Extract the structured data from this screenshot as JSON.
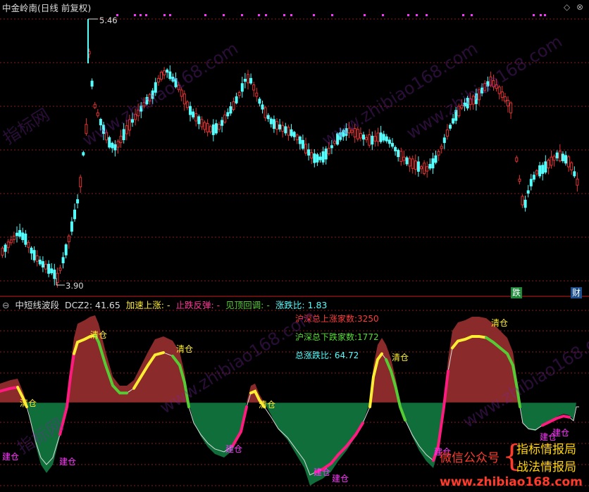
{
  "main_panel": {
    "title": "中金岭南(日线 前复权)",
    "high_label": "5.46",
    "low_label": "3.90",
    "badges": [
      "跌",
      "财"
    ]
  },
  "indicator_panel": {
    "title": "中短线波段",
    "dcz2_label": "DCZ2: 41.65",
    "accel_label": "加速上涨: -",
    "rebound_label": "止跌反弹: -",
    "top_label": "见顶回调: -",
    "ratio_label": "涨跌比: 1.83",
    "stats": {
      "up": "沪深总上涨家数:3250",
      "down": "沪深总下跌家数:1772",
      "ratio": "总涨跌比: 64.72"
    },
    "signals": {
      "build": "建仓",
      "clear": "清仓"
    }
  },
  "promo": {
    "prefix": "微信公众号",
    "line1": "指标情报局",
    "line2": "战法情报局",
    "url": "www.zhibiao168.com"
  },
  "watermarks": [
    "指标网",
    "www.zhibiao168.com"
  ],
  "colors": {
    "up": "#e03232",
    "down": "#54ffff",
    "grid": "#8b1a1a",
    "axis": "#a01818",
    "rise_fill": "#8b2a2a",
    "fall_fill": "#0f6e3a",
    "accel": "#ffee33",
    "top": "#55cc33",
    "rebound": "#ff1a80",
    "line": "#dddddd"
  },
  "chart_data": [
    {
      "type": "candlestick",
      "title": "中金岭南(日线 前复权)",
      "annotations": {
        "max": 5.46,
        "min": 3.9
      },
      "ylim": [
        3.8,
        5.55
      ]
    },
    {
      "type": "area",
      "title": "中短线波段",
      "series": [
        {
          "name": "DCZ2",
          "last": 41.65
        }
      ],
      "signals": [
        "建仓",
        "清仓"
      ]
    }
  ]
}
